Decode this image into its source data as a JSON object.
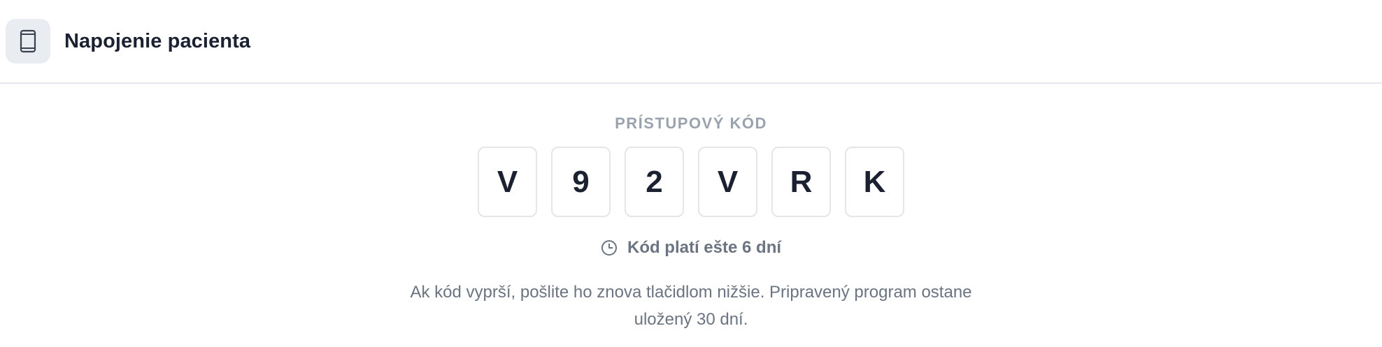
{
  "header": {
    "icon": "phone-icon",
    "title": "Napojenie pacienta"
  },
  "access_code": {
    "label": "PRÍSTUPOVÝ KÓD",
    "characters": [
      "V",
      "9",
      "2",
      "V",
      "R",
      "K"
    ]
  },
  "validity": {
    "icon": "clock-icon",
    "text": "Kód platí ešte 6 dní"
  },
  "note": {
    "text": "Ak kód vyprší, pošlite ho znova tlačidlom nižšie. Pripravený program ostane uložený 30 dní."
  },
  "colors": {
    "title": "#1b2130",
    "muted": "#6b7480",
    "label": "#9aa3ad",
    "border": "#e4e6ea",
    "icon_tile": "#e9ecf1"
  }
}
